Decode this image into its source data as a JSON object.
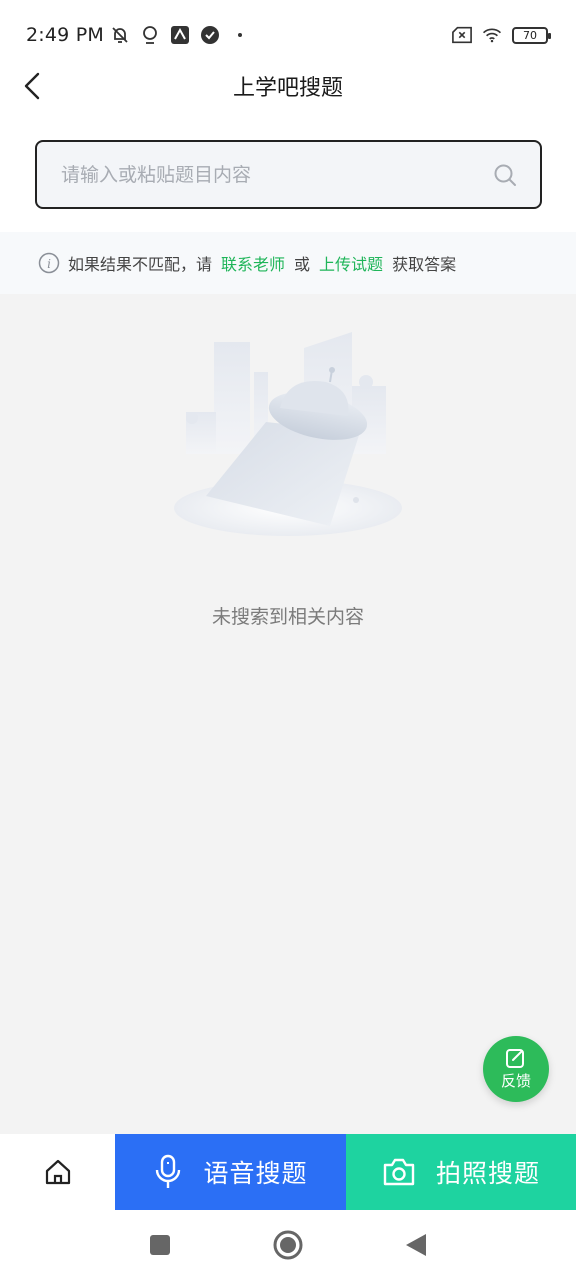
{
  "status_bar": {
    "time": "2:49 PM",
    "battery": "70"
  },
  "header": {
    "title": "上学吧搜题"
  },
  "search": {
    "placeholder": "请输入或粘贴题目内容",
    "value": ""
  },
  "notice": {
    "prefix": "如果结果不匹配，请",
    "link_teacher": "联系老师",
    "or": "或",
    "link_upload": "上传试题",
    "suffix": "获取答案"
  },
  "empty_state": {
    "message": "未搜索到相关内容"
  },
  "feedback": {
    "label": "反馈"
  },
  "bottom_bar": {
    "voice_label": "语音搜题",
    "photo_label": "拍照搜题"
  },
  "colors": {
    "accent_green": "#1fb559",
    "voice_blue": "#2b6ff5",
    "photo_teal": "#1ed3a0",
    "fab_green": "#2dbb5a"
  }
}
